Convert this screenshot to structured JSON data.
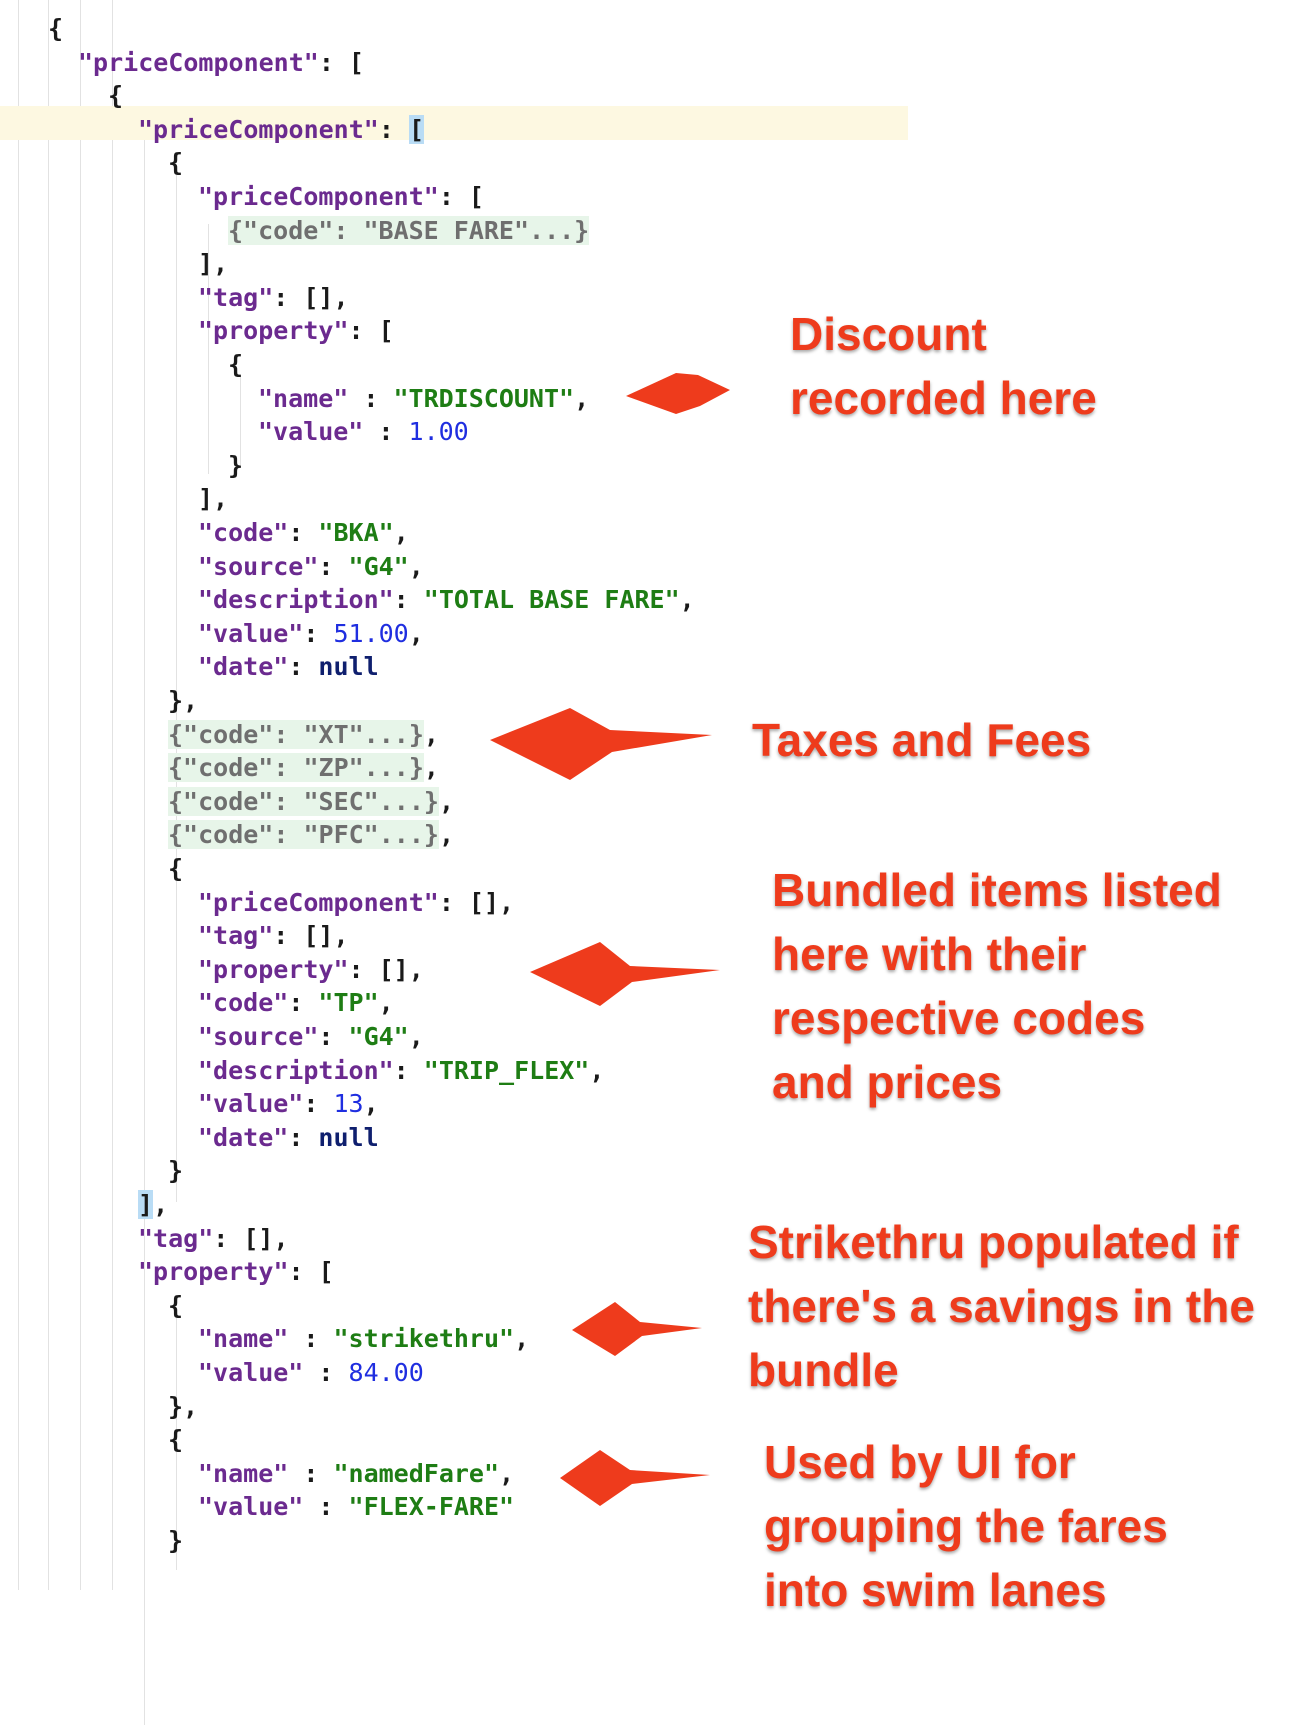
{
  "code_view": {
    "lines": [
      {
        "indent": 2,
        "tokens": [
          {
            "t": "{",
            "c": "p"
          }
        ]
      },
      {
        "indent": 3,
        "tokens": [
          {
            "t": "\"priceComponent\"",
            "c": "k"
          },
          {
            "t": ": [",
            "c": "p"
          }
        ]
      },
      {
        "indent": 4,
        "tokens": [
          {
            "t": "{",
            "c": "p"
          }
        ]
      },
      {
        "indent": 5,
        "highlight": true,
        "tokens": [
          {
            "t": "\"priceComponent\"",
            "c": "k"
          },
          {
            "t": ": ",
            "c": "p"
          },
          {
            "t": "[",
            "c": "p brk"
          }
        ]
      },
      {
        "indent": 6,
        "tokens": [
          {
            "t": "{",
            "c": "p"
          }
        ]
      },
      {
        "indent": 7,
        "tokens": [
          {
            "t": "\"priceComponent\"",
            "c": "k"
          },
          {
            "t": ": [",
            "c": "p"
          }
        ]
      },
      {
        "indent": 8,
        "tokens": [
          {
            "t": "{\"code\": \"BASE FARE\"...}",
            "c": "fold"
          }
        ]
      },
      {
        "indent": 7,
        "tokens": [
          {
            "t": "],",
            "c": "p"
          }
        ]
      },
      {
        "indent": 7,
        "tokens": [
          {
            "t": "\"tag\"",
            "c": "k"
          },
          {
            "t": ": [],",
            "c": "p"
          }
        ]
      },
      {
        "indent": 7,
        "tokens": [
          {
            "t": "\"property\"",
            "c": "k"
          },
          {
            "t": ": [",
            "c": "p"
          }
        ]
      },
      {
        "indent": 8,
        "tokens": [
          {
            "t": "{",
            "c": "p"
          }
        ]
      },
      {
        "indent": 9,
        "tokens": [
          {
            "t": "\"name\"",
            "c": "k"
          },
          {
            "t": " : ",
            "c": "p"
          },
          {
            "t": "\"TRDISCOUNT\"",
            "c": "s"
          },
          {
            "t": ",",
            "c": "p"
          }
        ]
      },
      {
        "indent": 9,
        "tokens": [
          {
            "t": "\"value\"",
            "c": "k"
          },
          {
            "t": " : ",
            "c": "p"
          },
          {
            "t": "1.00",
            "c": "n"
          }
        ]
      },
      {
        "indent": 8,
        "tokens": [
          {
            "t": "}",
            "c": "p"
          }
        ]
      },
      {
        "indent": 7,
        "tokens": [
          {
            "t": "],",
            "c": "p"
          }
        ]
      },
      {
        "indent": 7,
        "tokens": [
          {
            "t": "\"code\"",
            "c": "k"
          },
          {
            "t": ": ",
            "c": "p"
          },
          {
            "t": "\"BKA\"",
            "c": "s"
          },
          {
            "t": ",",
            "c": "p"
          }
        ]
      },
      {
        "indent": 7,
        "tokens": [
          {
            "t": "\"source\"",
            "c": "k"
          },
          {
            "t": ": ",
            "c": "p"
          },
          {
            "t": "\"G4\"",
            "c": "s"
          },
          {
            "t": ",",
            "c": "p"
          }
        ]
      },
      {
        "indent": 7,
        "tokens": [
          {
            "t": "\"description\"",
            "c": "k"
          },
          {
            "t": ": ",
            "c": "p"
          },
          {
            "t": "\"TOTAL BASE FARE\"",
            "c": "s"
          },
          {
            "t": ",",
            "c": "p"
          }
        ]
      },
      {
        "indent": 7,
        "tokens": [
          {
            "t": "\"value\"",
            "c": "k"
          },
          {
            "t": ": ",
            "c": "p"
          },
          {
            "t": "51.00",
            "c": "n"
          },
          {
            "t": ",",
            "c": "p"
          }
        ]
      },
      {
        "indent": 7,
        "tokens": [
          {
            "t": "\"date\"",
            "c": "k"
          },
          {
            "t": ": ",
            "c": "p"
          },
          {
            "t": "null",
            "c": "kw"
          }
        ]
      },
      {
        "indent": 6,
        "tokens": [
          {
            "t": "},",
            "c": "p"
          }
        ]
      },
      {
        "indent": 6,
        "tokens": [
          {
            "t": "{\"code\": \"XT\"...}",
            "c": "fold"
          },
          {
            "t": ",",
            "c": "p"
          }
        ]
      },
      {
        "indent": 6,
        "tokens": [
          {
            "t": "{\"code\": \"ZP\"...}",
            "c": "fold"
          },
          {
            "t": ",",
            "c": "p"
          }
        ]
      },
      {
        "indent": 6,
        "tokens": [
          {
            "t": "{\"code\": \"SEC\"...}",
            "c": "fold"
          },
          {
            "t": ",",
            "c": "p"
          }
        ]
      },
      {
        "indent": 6,
        "tokens": [
          {
            "t": "{\"code\": \"PFC\"...}",
            "c": "fold"
          },
          {
            "t": ",",
            "c": "p"
          }
        ]
      },
      {
        "indent": 6,
        "tokens": [
          {
            "t": "{",
            "c": "p"
          }
        ]
      },
      {
        "indent": 7,
        "tokens": [
          {
            "t": "\"priceComponent\"",
            "c": "k"
          },
          {
            "t": ": [],",
            "c": "p"
          }
        ]
      },
      {
        "indent": 7,
        "tokens": [
          {
            "t": "\"tag\"",
            "c": "k"
          },
          {
            "t": ": [],",
            "c": "p"
          }
        ]
      },
      {
        "indent": 7,
        "tokens": [
          {
            "t": "\"property\"",
            "c": "k"
          },
          {
            "t": ": [],",
            "c": "p"
          }
        ]
      },
      {
        "indent": 7,
        "tokens": [
          {
            "t": "\"code\"",
            "c": "k"
          },
          {
            "t": ": ",
            "c": "p"
          },
          {
            "t": "\"TP\"",
            "c": "s"
          },
          {
            "t": ",",
            "c": "p"
          }
        ]
      },
      {
        "indent": 7,
        "tokens": [
          {
            "t": "\"source\"",
            "c": "k"
          },
          {
            "t": ": ",
            "c": "p"
          },
          {
            "t": "\"G4\"",
            "c": "s"
          },
          {
            "t": ",",
            "c": "p"
          }
        ]
      },
      {
        "indent": 7,
        "tokens": [
          {
            "t": "\"description\"",
            "c": "k"
          },
          {
            "t": ": ",
            "c": "p"
          },
          {
            "t": "\"TRIP_FLEX\"",
            "c": "s"
          },
          {
            "t": ",",
            "c": "p"
          }
        ]
      },
      {
        "indent": 7,
        "tokens": [
          {
            "t": "\"value\"",
            "c": "k"
          },
          {
            "t": ": ",
            "c": "p"
          },
          {
            "t": "13",
            "c": "n"
          },
          {
            "t": ",",
            "c": "p"
          }
        ]
      },
      {
        "indent": 7,
        "tokens": [
          {
            "t": "\"date\"",
            "c": "k"
          },
          {
            "t": ": ",
            "c": "p"
          },
          {
            "t": "null",
            "c": "kw"
          }
        ]
      },
      {
        "indent": 6,
        "tokens": [
          {
            "t": "}",
            "c": "p"
          }
        ]
      },
      {
        "indent": 5,
        "tokens": [
          {
            "t": "]",
            "c": "p brk"
          },
          {
            "t": ",",
            "c": "p"
          }
        ]
      },
      {
        "indent": 5,
        "tokens": [
          {
            "t": "\"tag\"",
            "c": "k"
          },
          {
            "t": ": [],",
            "c": "p"
          }
        ]
      },
      {
        "indent": 5,
        "tokens": [
          {
            "t": "\"property\"",
            "c": "k"
          },
          {
            "t": ": [",
            "c": "p"
          }
        ]
      },
      {
        "indent": 6,
        "tokens": [
          {
            "t": "{",
            "c": "p"
          }
        ]
      },
      {
        "indent": 7,
        "tokens": [
          {
            "t": "\"name\"",
            "c": "k"
          },
          {
            "t": " : ",
            "c": "p"
          },
          {
            "t": "\"strikethru\"",
            "c": "s"
          },
          {
            "t": ",",
            "c": "p"
          }
        ]
      },
      {
        "indent": 7,
        "tokens": [
          {
            "t": "\"value\"",
            "c": "k"
          },
          {
            "t": " : ",
            "c": "p"
          },
          {
            "t": "84.00",
            "c": "n"
          }
        ]
      },
      {
        "indent": 6,
        "tokens": [
          {
            "t": "},",
            "c": "p"
          }
        ]
      },
      {
        "indent": 6,
        "tokens": [
          {
            "t": "{",
            "c": "p"
          }
        ]
      },
      {
        "indent": 7,
        "tokens": [
          {
            "t": "\"name\"",
            "c": "k"
          },
          {
            "t": " : ",
            "c": "p"
          },
          {
            "t": "\"namedFare\"",
            "c": "s"
          },
          {
            "t": ",",
            "c": "p"
          }
        ]
      },
      {
        "indent": 7,
        "tokens": [
          {
            "t": "\"value\"",
            "c": "k"
          },
          {
            "t": " : ",
            "c": "p"
          },
          {
            "t": "\"FLEX-FARE\"",
            "c": "s"
          }
        ]
      },
      {
        "indent": 6,
        "tokens": [
          {
            "t": "}",
            "c": "p"
          }
        ]
      }
    ]
  },
  "annotations": {
    "discount": [
      "Discount",
      "recorded here"
    ],
    "taxes": [
      "Taxes and Fees"
    ],
    "bundled": [
      "Bundled items listed",
      "here with their",
      "respective codes",
      "and prices"
    ],
    "strikethru": [
      "Strikethru populated if",
      "there's a savings in the",
      "bundle"
    ],
    "grouping": [
      "Used by UI for",
      "grouping the fares",
      "into swim lanes"
    ]
  },
  "colors": {
    "annotation": "#ee3b1c",
    "json_key": "#6b2a8f",
    "json_string": "#1e7d14",
    "json_number": "#1f2ee0",
    "json_keyword": "#0f1f6e",
    "folded_block_bg": "#e7f5e9",
    "caret_line_bg": "#fdf8e1",
    "bracket_match_bg": "#b9dcf5"
  }
}
